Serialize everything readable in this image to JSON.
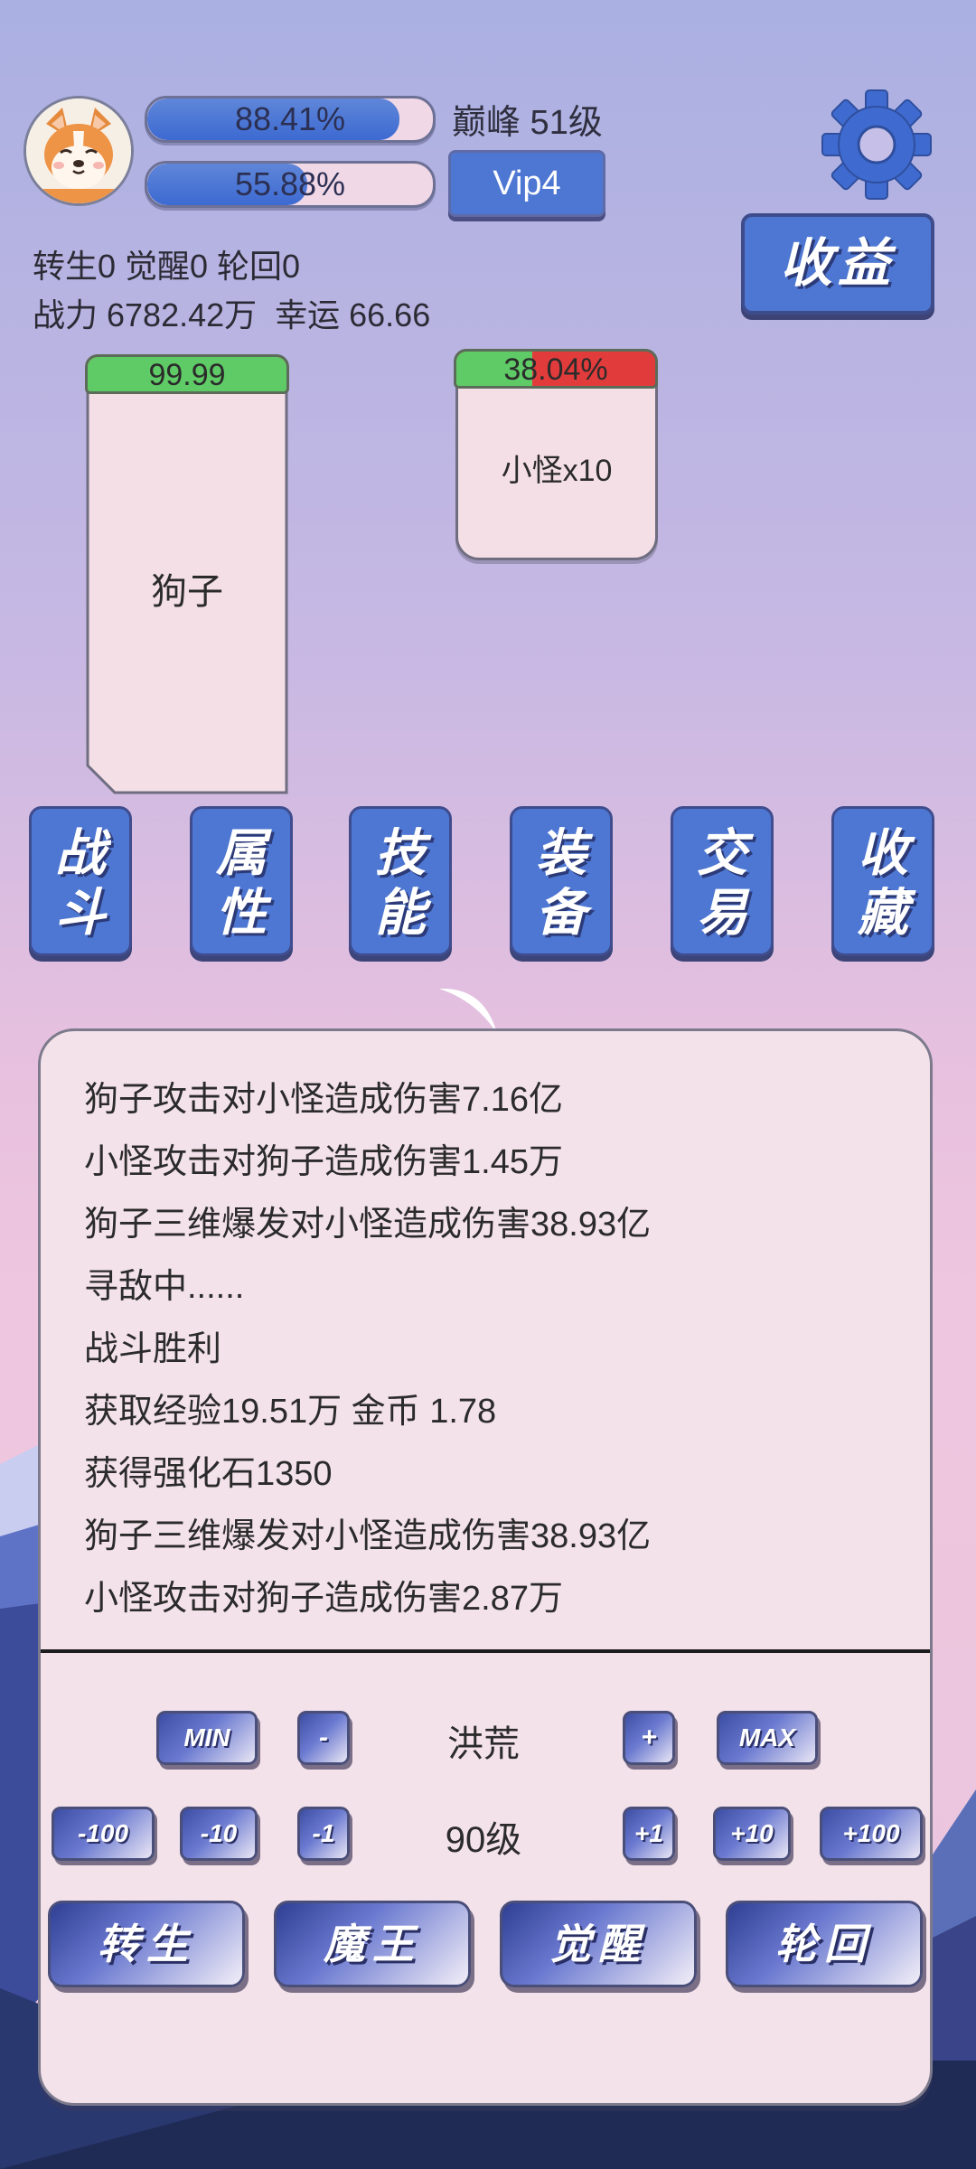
{
  "header": {
    "avatar_icon": "corgi-avatar-icon",
    "exp_bar": {
      "progress": 0.8841,
      "text": "88.41%"
    },
    "second_bar": {
      "progress": 0.5588,
      "text": "55.88%"
    },
    "peak_level": "巅峰 51级",
    "vip_label": "Vip4",
    "settings_icon": "gear-icon",
    "income_label": "收益"
  },
  "stats": {
    "line1": "转生0 觉醒0 轮回0",
    "line2": "战力 6782.42万  幸运 66.66"
  },
  "battle": {
    "player": {
      "name": "狗子",
      "hp_value": 0.9999,
      "hp_text": "99.99"
    },
    "enemy": {
      "name": "小怪x10",
      "hp_value": 0.3804,
      "hp_text": "38.04%"
    }
  },
  "tabs": [
    {
      "line1": "战",
      "line2": "斗"
    },
    {
      "line1": "属",
      "line2": "性"
    },
    {
      "line1": "技",
      "line2": "能"
    },
    {
      "line1": "装",
      "line2": "备"
    },
    {
      "line1": "交",
      "line2": "易"
    },
    {
      "line1": "收",
      "line2": "藏"
    }
  ],
  "log": [
    "狗子攻击对小怪造成伤害7.16亿",
    "小怪攻击对狗子造成伤害1.45万",
    "狗子三维爆发对小怪造成伤害38.93亿",
    "寻敌中......",
    "战斗胜利",
    "获取经验19.51万 金币 1.78",
    "获得强化石1350",
    "狗子三维爆发对小怪造成伤害38.93亿",
    "小怪攻击对狗子造成伤害2.87万"
  ],
  "controls": {
    "min_label": "MIN",
    "minus_label": "-",
    "region_name": "洪荒",
    "plus_label": "+",
    "max_label": "MAX",
    "minus100_label": "-100",
    "minus10_label": "-10",
    "minus1_label": "-1",
    "level_text": "90级",
    "plus1_label": "+1",
    "plus10_label": "+10",
    "plus100_label": "+100",
    "rebirth_label": "转生",
    "demon_label": "魔王",
    "awaken_label": "觉醒",
    "reincarnate_label": "轮回"
  },
  "colors": {
    "accent_blue": "#4d77d2",
    "hp_green": "#5fcb66",
    "hp_red": "#e23b3b"
  }
}
